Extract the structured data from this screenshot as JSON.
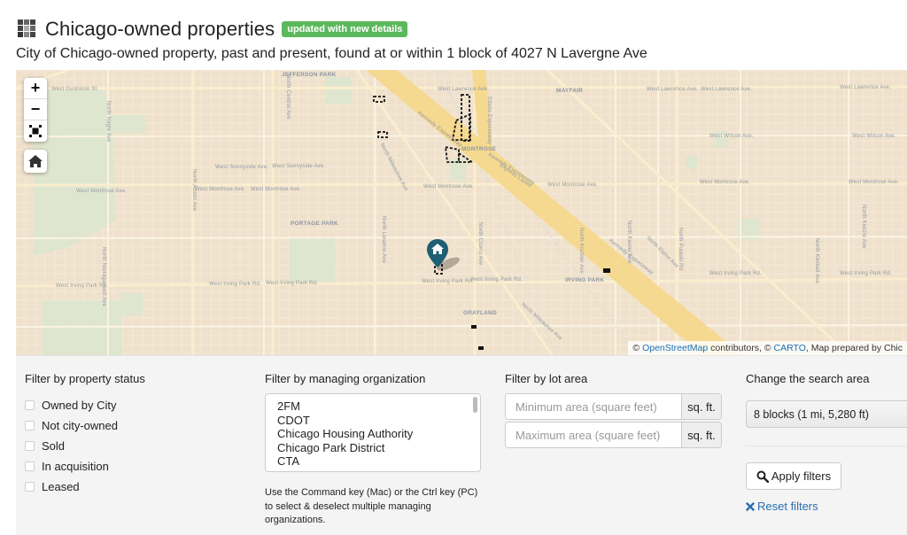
{
  "header": {
    "app_icon": "grid-squares-icon",
    "title": "Chicago-owned properties",
    "badge": "updated with new details",
    "badge_color": "#5cb85c",
    "subtitle": "City of Chicago-owned property, past and present, found at or within 1 block of 4027 N Lavergne Ave"
  },
  "map": {
    "controls": {
      "zoom_in": "+",
      "zoom_out": "−",
      "fullscreen_icon": "fullscreen-icon",
      "home_icon": "home-icon"
    },
    "marker_icon": "home-marker-icon",
    "marker_color": "#1f5f74",
    "labels": {
      "jefferson_park": "JEFFERSON PARK",
      "gunnison": "West Gunnison St.",
      "lawrence_1": "West Lawrence Ave.",
      "lawrence_2": "West Lawrence Ave.",
      "lawrence_3": "West Lawrence Ave.",
      "lawrence_4": "West Lawrence Ave.",
      "mayfair": "MAYFAIR",
      "wilson_1": "West Wilson Ave.",
      "wilson_2": "West Wilson Ave.",
      "sunnyside_1": "West Sunnyside Ave.",
      "sunnyside_2": "West Sunnyside Ave.",
      "montrose_area": "MONTROSE",
      "montrose_1": "West Montrose Ave.",
      "montrose_2": "West Montrose Ave.",
      "montrose_3": "West Montrose Ave.",
      "montrose_4": "West Montrose Ave.",
      "montrose_5": "West Montrose Ave.",
      "montrose_6": "West Montrose Ave.",
      "montrose_7": "West Montrose Ave.",
      "portage_park": "PORTAGE PARK",
      "irving_1": "West Irving Park Rd.",
      "irving_2": "West Irving Park Rd.",
      "irving_3": "West Irving Park Rd.",
      "irving_4": "West Irving Park Rd.",
      "irving_5": "West Irving Park Rd.",
      "irving_6": "West Irving Park Rd.",
      "irving_7": "West Irving Park Rd.",
      "irving_area": "IRVING PARK",
      "grayland": "GRAYLAND",
      "kennedy_1": "Kennedy Expressway",
      "kennedy_2": "Kennedy Expressway",
      "kennedy_3": "Kennedy Expressway",
      "express_lanes": "Express Lanes",
      "edens": "Edens Expressway",
      "n_milwaukee_1": "North Milwaukee Ave",
      "n_milwaukee_2": "North Milwaukee Ave",
      "n_central": "North Central Ave",
      "n_austin": "North Austin Ave",
      "n_laramie": "North Laramie Ave",
      "n_cicero": "North Cicero Ave",
      "n_pulaski": "North Pulaski Rd",
      "n_elston": "North Elston Ave",
      "n_kedzie": "North Kedzie Ave",
      "n_kimball": "North Kimball Ave",
      "n_keeler": "North Keeler Ave",
      "n_kostner": "North Kostner Ave",
      "n_narragansett": "North Narragansett Ave",
      "n_nagle": "North Nagle Ave"
    },
    "attribution": {
      "prefix": "© ",
      "osm_link": "OpenStreetMap",
      "mid": " contributors, © ",
      "carto_link": "CARTO",
      "suffix": ", Map prepared by Chic"
    }
  },
  "filters": {
    "status": {
      "title": "Filter by property status",
      "options": [
        {
          "label": "Owned by City",
          "checked": false
        },
        {
          "label": "Not city-owned",
          "checked": false
        },
        {
          "label": "Sold",
          "checked": false
        },
        {
          "label": "In acquisition",
          "checked": false
        },
        {
          "label": "Leased",
          "checked": false
        }
      ]
    },
    "organization": {
      "title": "Filter by managing organization",
      "options": [
        "2FM",
        "CDOT",
        "Chicago Housing Authority",
        "Chicago Park District",
        "CTA"
      ],
      "help": "Use the Command key (Mac) or the Ctrl key (PC) to select & deselect multiple managing organizations."
    },
    "lot_area": {
      "title": "Filter by lot area",
      "min_placeholder": "Minimum area (square feet)",
      "max_placeholder": "Maximum area (square feet)",
      "min_value": "",
      "max_value": "",
      "unit": "sq. ft."
    },
    "search_area": {
      "title": "Change the search area",
      "selected": "8 blocks (1 mi, 5,280 ft)"
    },
    "apply_label": "Apply filters",
    "apply_icon": "search-icon",
    "reset_label": "Reset filters",
    "reset_icon": "close-icon",
    "link_color": "#2a6db0"
  }
}
